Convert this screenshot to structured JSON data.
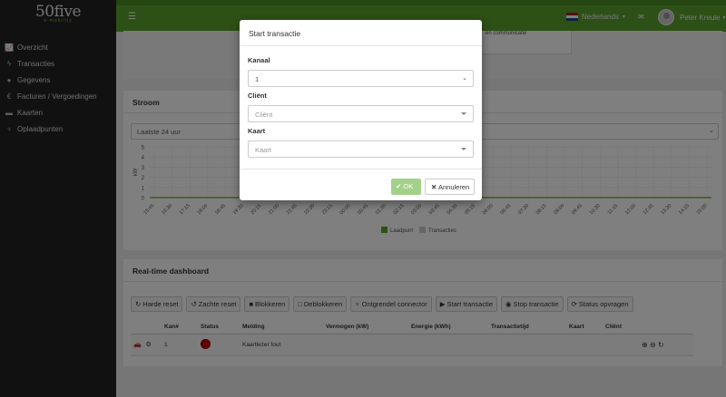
{
  "brand": {
    "name": "50five",
    "tagline": "e-mobility"
  },
  "sidebar": {
    "items": [
      {
        "label": "Overzicht",
        "icon": "chart-icon"
      },
      {
        "label": "Transacties",
        "icon": "bolt-icon"
      },
      {
        "label": "Gegevens",
        "icon": "user-icon"
      },
      {
        "label": "Facturen / Vergoedingen",
        "icon": "euro-icon"
      },
      {
        "label": "Kaarten",
        "icon": "card-icon"
      },
      {
        "label": "Oplaadpunten",
        "icon": "plug-icon"
      }
    ]
  },
  "topbar": {
    "language": "Nederlands",
    "user_name": "Peter Kreule"
  },
  "top_panel": {
    "snippet": "en communicatie"
  },
  "stroom": {
    "title": "Stroom",
    "period": "Laatste 24 uur",
    "ylabel": "kW"
  },
  "chart_data": {
    "type": "bar",
    "x": [
      "15:45",
      "16:30",
      "17:15",
      "18:00",
      "18:45",
      "19:30",
      "20:15",
      "21:00",
      "21:45",
      "22:30",
      "23:15",
      "00:00",
      "00:45",
      "01:30",
      "02:15",
      "03:00",
      "03:45",
      "04:30",
      "05:15",
      "06:00",
      "06:45",
      "07:30",
      "08:15",
      "09:00",
      "09:45",
      "10:30",
      "11:15",
      "12:00",
      "12:45",
      "13:30",
      "14:15",
      "15:00"
    ],
    "yticks": [
      0,
      1,
      2,
      3,
      4,
      5
    ],
    "ylim": [
      0,
      5
    ],
    "ylabel": "kW",
    "grid": true,
    "legend": "bottom",
    "series": [
      {
        "name": "Laadpunt",
        "color": "#5aa02c",
        "values": []
      },
      {
        "name": "Transacties",
        "color": "#cccccc",
        "values": []
      }
    ]
  },
  "realtime": {
    "title": "Real-time dashboard",
    "buttons": [
      {
        "label": "Harde reset",
        "icon": "refresh-icon"
      },
      {
        "label": "Zachte reset",
        "icon": "undo-icon"
      },
      {
        "label": "Blokkeren",
        "icon": "lock-icon"
      },
      {
        "label": "Deblokkeren",
        "icon": "unlock-icon"
      },
      {
        "label": "Ontgrendel connector",
        "icon": "plug-icon"
      },
      {
        "label": "Start transactie",
        "icon": "play-icon"
      },
      {
        "label": "Stop transactie",
        "icon": "stop-icon"
      },
      {
        "label": "Status opvragen",
        "icon": "sync-icon"
      }
    ],
    "columns": [
      "Kan#",
      "Status",
      "Melding",
      "Vermogen (kW)",
      "Energie (kWh)",
      "Transactietijd",
      "Kaart",
      "Cliënt"
    ],
    "rows": [
      {
        "kan": "1",
        "status_color": "#cc0000",
        "melding": "Kaartlezer fout",
        "vermogen": "",
        "energie": "",
        "tijd": "",
        "kaart": "",
        "client": ""
      }
    ]
  },
  "modal": {
    "title": "Start transactie",
    "kanaal_label": "Kanaal",
    "kanaal_value": "1",
    "client_label": "Cliënt",
    "client_placeholder": "Cliënt",
    "kaart_label": "Kaart",
    "kaart_placeholder": "Kaart",
    "ok_label": "OK",
    "cancel_label": "Annuleren"
  }
}
